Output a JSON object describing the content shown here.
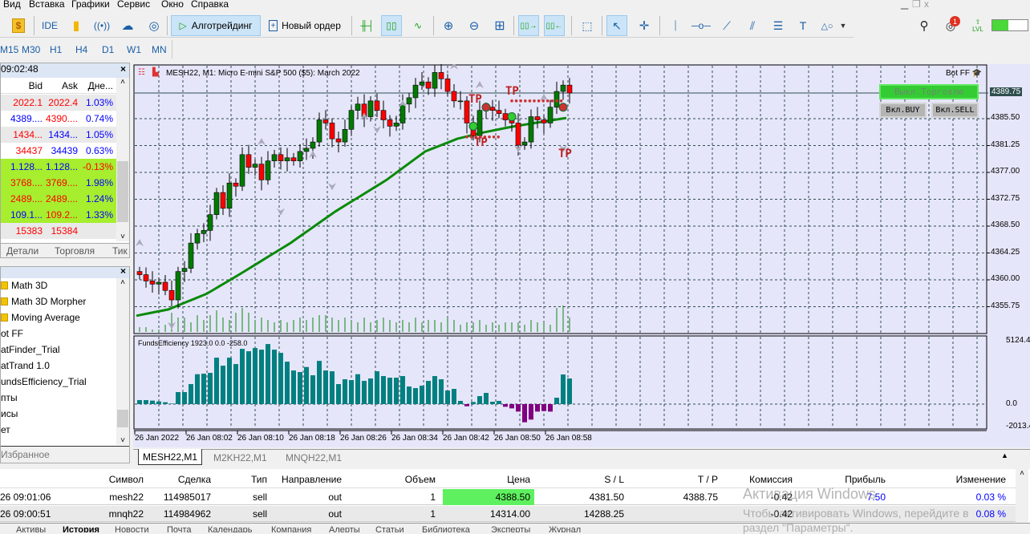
{
  "menu": [
    "Вид",
    "Вставка",
    "Графики",
    "Сервис",
    "Окно",
    "Справка"
  ],
  "toolbar": {
    "ide": "IDE",
    "algo": "Алготрейдинг",
    "new_order": "Новый ордер",
    "notifications": "1",
    "level": "LVL",
    "level_fraction": 0.45
  },
  "timeframes": [
    "M15",
    "M30",
    "H1",
    "H4",
    "D1",
    "W1",
    "MN"
  ],
  "market_watch": {
    "time": "09:02:48",
    "columns": [
      "Bid",
      "Ask",
      "Дне..."
    ],
    "rows": [
      {
        "bid": "2022.1",
        "ask": "2022.4",
        "chg": "1.03%",
        "bid_c": "#ff0000",
        "ask_c": "#ff0000",
        "chg_c": "#0000ff",
        "bg": "#e9e9e9"
      },
      {
        "bid": "4389....",
        "ask": "4390....",
        "chg": "0.74%",
        "bid_c": "#0000ff",
        "ask_c": "#ff0000",
        "chg_c": "#0000ff",
        "bg": "#ffffff"
      },
      {
        "bid": "1434...",
        "ask": "1434...",
        "chg": "1.05%",
        "bid_c": "#ff0000",
        "ask_c": "#0000ff",
        "chg_c": "#0000ff",
        "bg": "#e9e9e9"
      },
      {
        "bid": "34437",
        "ask": "34439",
        "chg": "0.63%",
        "bid_c": "#ff0000",
        "ask_c": "#0000ff",
        "chg_c": "#0000ff",
        "bg": "#ffffff"
      },
      {
        "bid": "1.128...",
        "ask": "1.128...",
        "chg": "-0.13%",
        "bid_c": "#0000ff",
        "ask_c": "#0000ff",
        "chg_c": "#ff0000",
        "bg": "#a6ee2e"
      },
      {
        "bid": "3768....",
        "ask": "3769....",
        "chg": "1.98%",
        "bid_c": "#ff0000",
        "ask_c": "#ff0000",
        "chg_c": "#0000ff",
        "bg": "#a6ee2e"
      },
      {
        "bid": "2489....",
        "ask": "2489....",
        "chg": "1.24%",
        "bid_c": "#ff0000",
        "ask_c": "#ff0000",
        "chg_c": "#0000ff",
        "bg": "#a6ee2e"
      },
      {
        "bid": "109.1...",
        "ask": "109.2...",
        "chg": "1.33%",
        "bid_c": "#0000ff",
        "ask_c": "#ff0000",
        "chg_c": "#0000ff",
        "bg": "#a6ee2e"
      },
      {
        "bid": "15383",
        "ask": "15384",
        "chg": "",
        "bid_c": "#ff0000",
        "ask_c": "#ff0000",
        "chg_c": "#0000ff",
        "bg": "#e9e9e9"
      }
    ],
    "tabs": [
      "Детали",
      "Торговля",
      "Тик"
    ]
  },
  "navigator": {
    "items": [
      {
        "label": "Math 3D",
        "folder": true
      },
      {
        "label": "Math 3D Morpher",
        "folder": true
      },
      {
        "label": "Moving Average",
        "folder": true
      },
      {
        "label": "ot FF",
        "folder": false
      },
      {
        "label": "atFinder_Trial",
        "folder": false
      },
      {
        "label": "atTrand 1.0",
        "folder": false
      },
      {
        "label": "undsEfficiency_Trial",
        "folder": false
      },
      {
        "label": "пты",
        "folder": false
      },
      {
        "label": "исы",
        "folder": false
      },
      {
        "label": "ет",
        "folder": false
      }
    ],
    "tab": "Избранное"
  },
  "chart": {
    "title": "MESH22, M1:  Micro E-mini S&P 500 ($5): March 2022",
    "bot": "Bot FF",
    "current_price": "4389.75",
    "price_labels": [
      "4385.50",
      "4381.25",
      "4377.00",
      "4372.75",
      "4368.50",
      "4364.25",
      "4360.00",
      "4355.75"
    ],
    "ind_title": "FundsEfficiency 1923.0 0.0 -258.0",
    "ind_labels": [
      "5124.4",
      "0.0",
      "-2013.4"
    ],
    "time_labels": [
      "26 Jan 2022",
      "26 Jan 08:02",
      "26 Jan 08:10",
      "26 Jan 08:18",
      "26 Jan 08:26",
      "26 Jan 08:34",
      "26 Jan 08:42",
      "26 Jan 08:50",
      "26 Jan 08:58"
    ],
    "btn_trade": "Выкл.Торговлю",
    "btn_buy": "Вкл.BUY",
    "btn_sell": "Вкл.SELL",
    "tp": "TP",
    "colors": {
      "bull": "#007a00",
      "bear": "#ff0000",
      "ma": "#0a8a0a",
      "hist_pos": "#008080",
      "hist_neg": "#800080"
    }
  },
  "chart_data": {
    "type": "candlestick",
    "closes": [
      4361.0,
      4360.0,
      4359.5,
      4359.8,
      4358.5,
      4357.0,
      4361.5,
      4362.0,
      4366.0,
      4367.5,
      4368.0,
      4370.5,
      4374.0,
      4371.5,
      4375.5,
      4375.0,
      4380.0,
      4378.0,
      4378.5,
      4376.0,
      4379.0,
      4380.0,
      4379.0,
      4379.5,
      4379.0,
      4380.5,
      4381.0,
      4382.0,
      4385.5,
      4385.0,
      4382.5,
      4382.0,
      4384.0,
      4387.0,
      4388.0,
      4386.0,
      4388.5,
      4387.0,
      4385.5,
      4384.5,
      4385.0,
      4388.0,
      4389.0,
      4391.0,
      4391.5,
      4390.5,
      4393.0,
      4392.0,
      4390.0,
      4388.5,
      4388.5,
      4385.0,
      4383.0,
      4387.0,
      4387.5,
      4387.0,
      4386.5,
      4385.5,
      4385.0,
      4381.5,
      4382.0,
      4386.0,
      4385.5,
      4385.0,
      4387.5,
      4390.0,
      4391.0,
      4389.75
    ],
    "ma_anchors": [
      [
        0,
        4354.5
      ],
      [
        5,
        4355.5
      ],
      [
        11,
        4358
      ],
      [
        16,
        4361
      ],
      [
        24,
        4366
      ],
      [
        31,
        4371
      ],
      [
        39,
        4376
      ],
      [
        45,
        4380.5
      ],
      [
        50,
        4382.5
      ],
      [
        54,
        4383.5
      ],
      [
        59,
        4384.5
      ],
      [
        67,
        4385.8
      ]
    ],
    "volume": [
      2,
      2,
      1,
      1,
      3,
      8,
      6,
      6,
      4,
      7,
      5,
      7,
      9,
      6,
      5,
      8,
      10,
      8,
      5,
      6,
      5,
      4,
      5,
      4,
      5,
      6,
      5,
      6,
      7,
      7,
      6,
      5,
      6,
      5,
      4,
      6,
      4,
      5,
      6,
      5,
      4,
      5,
      4,
      6,
      4,
      5,
      5,
      4,
      6,
      5,
      3,
      4,
      4,
      5,
      3,
      4,
      3,
      4,
      4,
      4,
      3,
      5,
      4,
      4,
      3,
      10,
      11,
      6
    ],
    "funds_efficiency": [
      324,
      324,
      281,
      216,
      151,
      43,
      972,
      972,
      1620,
      2419,
      2462,
      2527,
      3758,
      3110,
      3758,
      3240,
      4471,
      4277,
      4536,
      4406,
      4860,
      4406,
      4147,
      3434,
      2722,
      2592,
      3002,
      2333,
      3499,
      2722,
      2657,
      1620,
      2009,
      1944,
      2419,
      1879,
      2074,
      2657,
      2268,
      2138,
      2138,
      2268,
      1426,
      1296,
      1490,
      1879,
      2268,
      2009,
      1102,
      1231,
      259,
      -173,
      173,
      648,
      907,
      194,
      259,
      -216,
      -346,
      -605,
      -1469,
      -1253,
      -605,
      -562,
      -605,
      518,
      2398,
      2074
    ],
    "price_range": [
      4352,
      4394
    ],
    "ind_range": [
      -2013.4,
      5124.4
    ]
  },
  "charttabs": [
    "MESH22,M1",
    "M2KH22,M1",
    "MNQH22,M1"
  ],
  "trades": {
    "columns": [
      "Символ",
      "Сделка",
      "Тип",
      "Направление",
      "Объем",
      "Цена",
      "S / L",
      "T / P",
      "Комиссия",
      "Прибыль",
      "Изменение"
    ],
    "rows": [
      {
        "time": "26 09:01:06",
        "symbol": "mesh22",
        "deal": "114985017",
        "type": "sell",
        "dir": "out",
        "vol": "1",
        "price": "4388.50",
        "sl": "4381.50",
        "tp": "4388.75",
        "comm": "-0.42",
        "profit": "7.50",
        "chg": "0.03 %"
      },
      {
        "time": "26 09:00:51",
        "symbol": "mnqh22",
        "deal": "114984962",
        "type": "sell",
        "dir": "out",
        "vol": "1",
        "price": "14314.00",
        "sl": "14288.25",
        "tp": "",
        "comm": "-0.42",
        "profit": "",
        "chg": "0.08 %"
      }
    ]
  },
  "bottom_tabs": [
    "Активы",
    "История",
    "Новости",
    "Почта",
    "Календарь",
    "Компания",
    "Алерты",
    "Статьи",
    "Библиотека",
    "Эксперты",
    "Журнал"
  ],
  "watermark": {
    "line1": "Активация Windows",
    "line2": "Чтобы активировать Windows, перейдите в",
    "line3": "раздел \"Параметры\"."
  }
}
